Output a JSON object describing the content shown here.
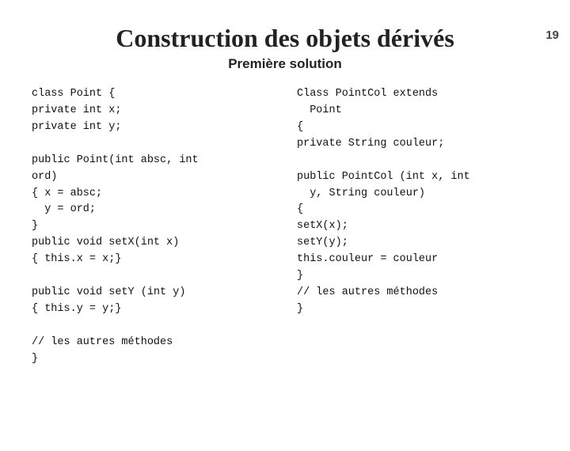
{
  "slide": {
    "number": "19",
    "title": "Construction des objets dérivés",
    "subtitle": "Première solution",
    "left_code": "class Point {\nprivate int x;\nprivate int y;\n\npublic Point(int absc, int\nord)\n{ x = absc;\n  y = ord;\n}\npublic void setX(int x)\n{ this.x = x;}\n\npublic void setY (int y)\n{ this.y = y;}\n\n// les autres méthodes\n}",
    "right_code": "Class PointCol extends\n  Point\n{\nprivate String couleur;\n\npublic PointCol (int x, int\n  y, String couleur)\n{\nsetX(x);\nsetY(y);\nthis.couleur = couleur\n}\n// les autres méthodes\n}"
  }
}
